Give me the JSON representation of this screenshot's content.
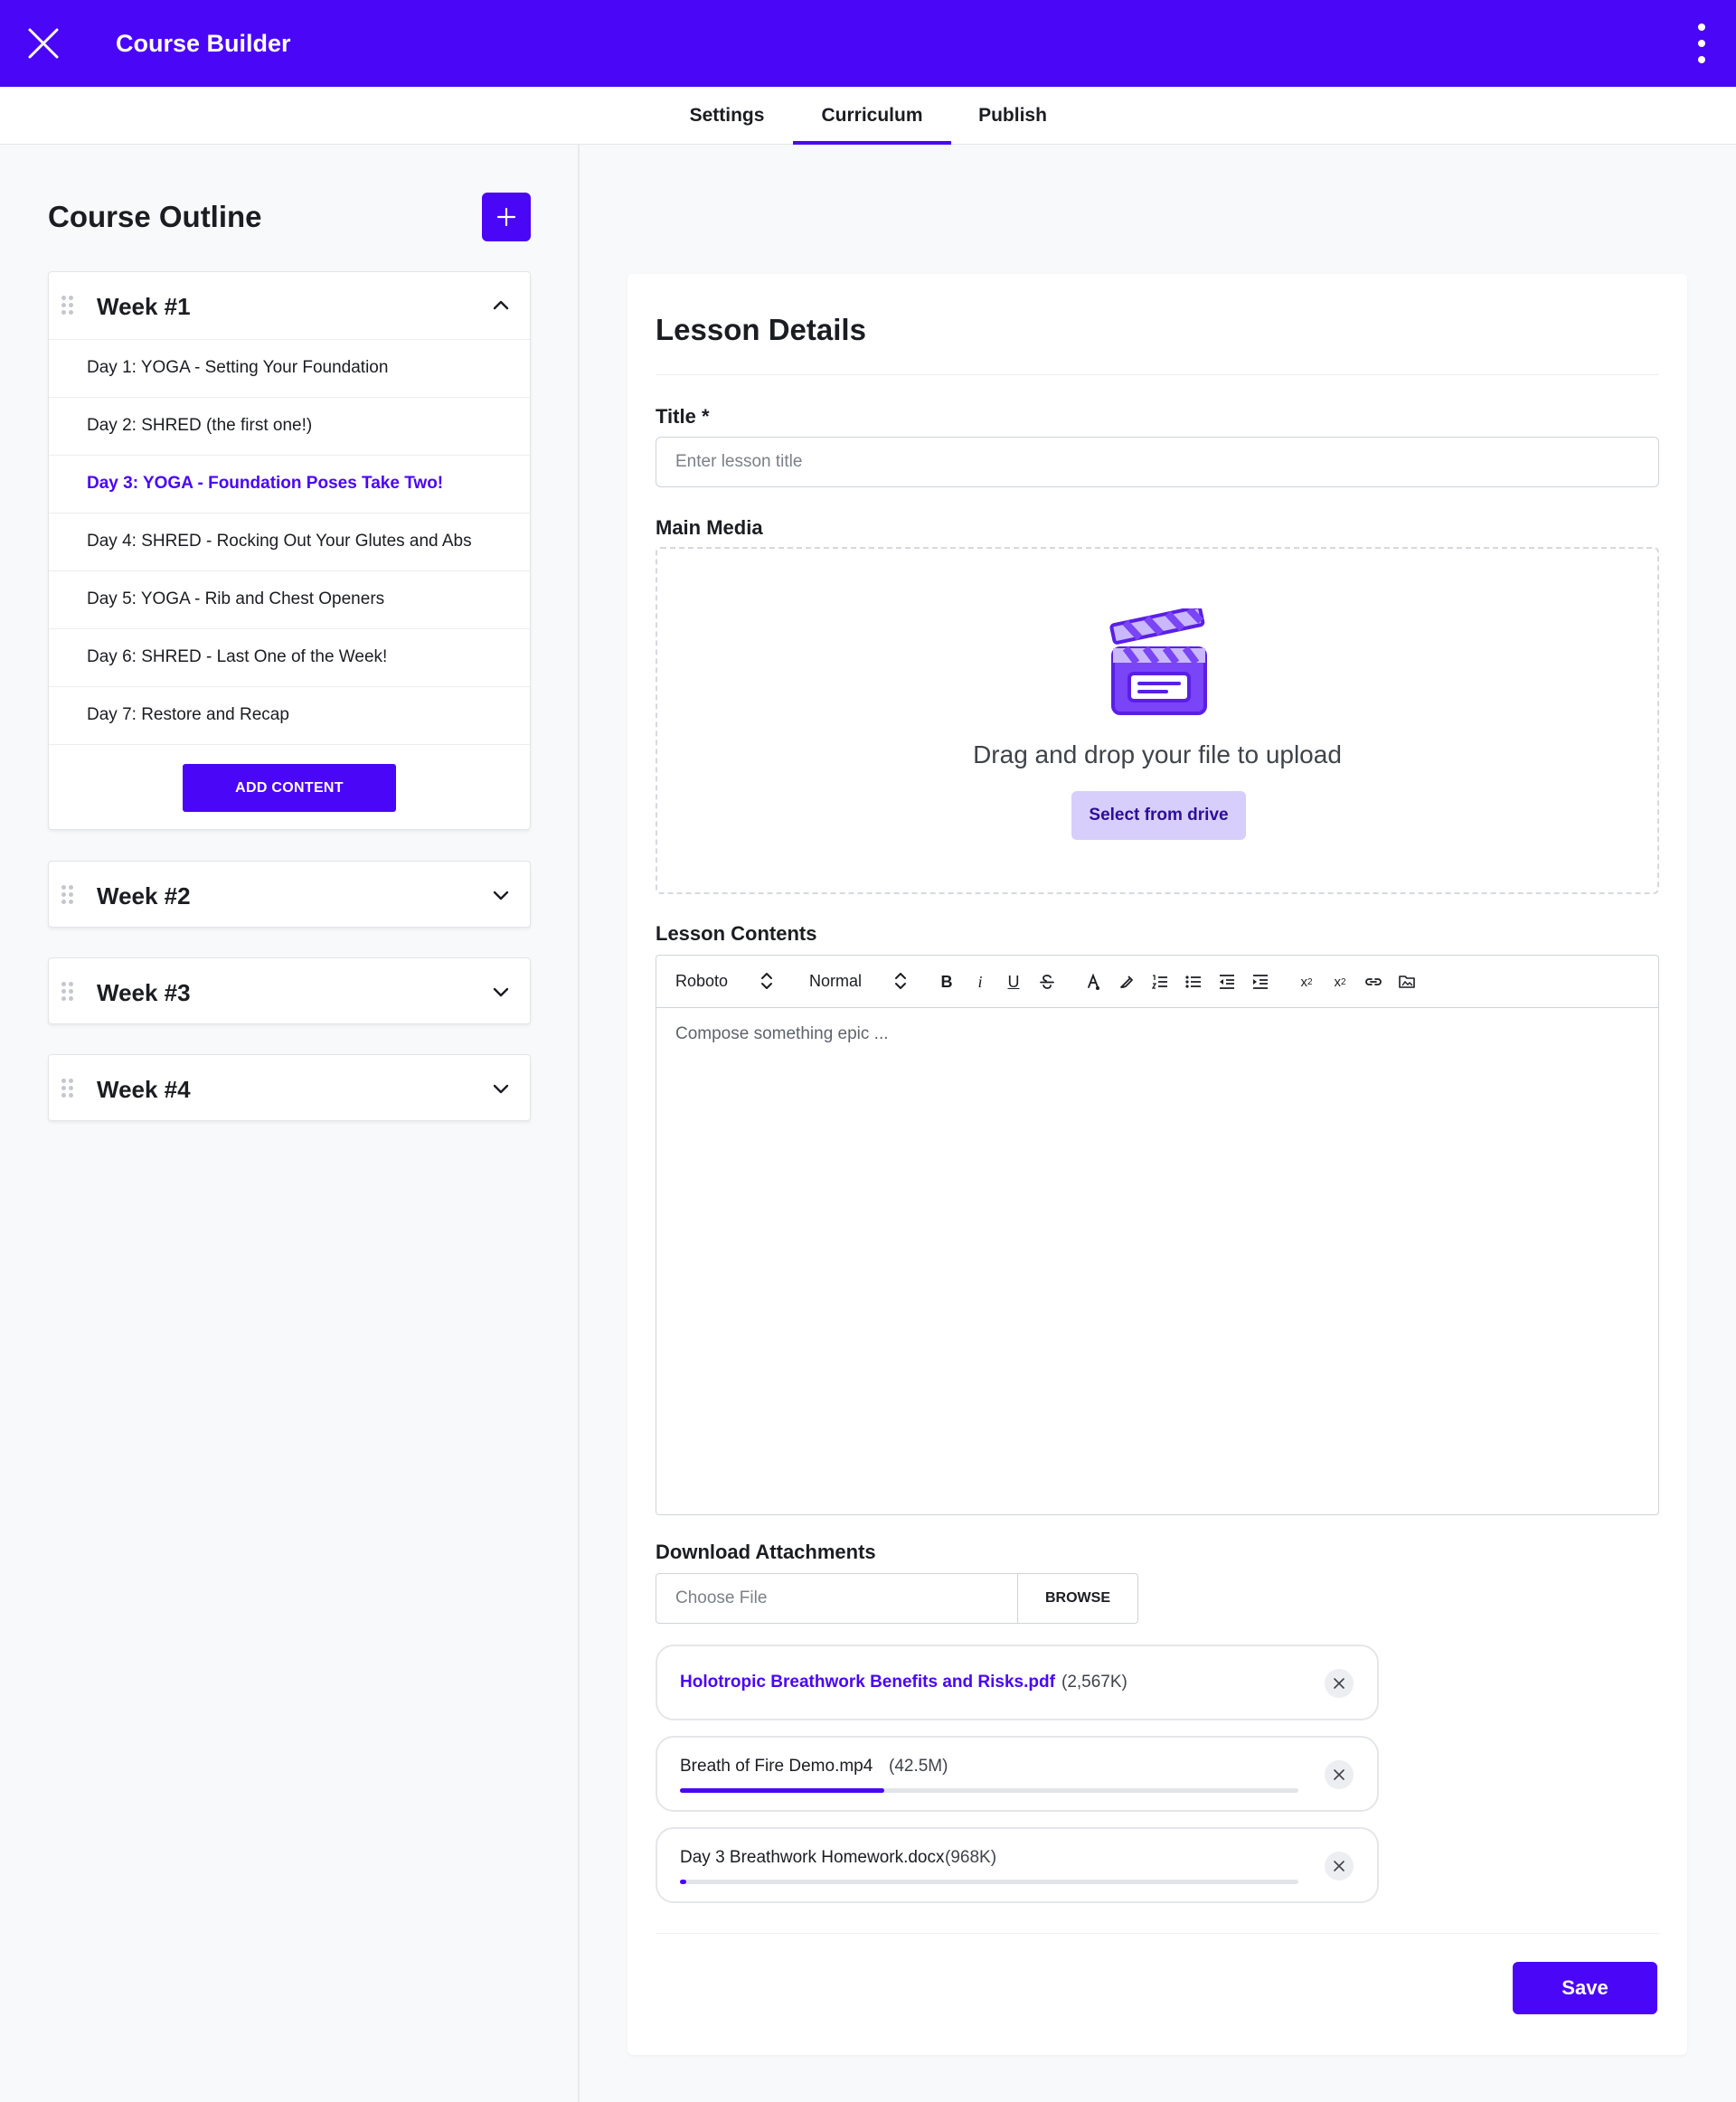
{
  "app": {
    "title": "Course Builder",
    "accent_color": "#4a06f7",
    "close_icon": "close-icon",
    "menu_icon": "more-vertical-icon"
  },
  "tabs": [
    {
      "label": "Settings",
      "active": false
    },
    {
      "label": "Curriculum",
      "active": true
    },
    {
      "label": "Publish",
      "active": false
    }
  ],
  "outline": {
    "title": "Course Outline",
    "add_icon": "plus-icon",
    "weeks": [
      {
        "label": "Week #1",
        "expanded": true,
        "days": [
          {
            "label": "Day 1: YOGA - Setting Your Foundation",
            "active": false
          },
          {
            "label": "Day 2: SHRED (the first one!)",
            "active": false
          },
          {
            "label": "Day 3: YOGA - Foundation Poses Take Two!",
            "active": true
          },
          {
            "label": "Day 4: SHRED - Rocking Out Your Glutes and Abs",
            "active": false
          },
          {
            "label": "Day 5: YOGA - Rib and Chest Openers",
            "active": false
          },
          {
            "label": "Day 6: SHRED - Last One of the Week!",
            "active": false
          },
          {
            "label": "Day 7: Restore and Recap",
            "active": false
          }
        ],
        "add_content_label": "ADD CONTENT"
      },
      {
        "label": "Week #2",
        "expanded": false
      },
      {
        "label": "Week #3",
        "expanded": false
      },
      {
        "label": "Week #4",
        "expanded": false
      }
    ]
  },
  "lesson": {
    "heading": "Lesson Details",
    "title_label": "Title *",
    "title_placeholder": "Enter lesson title",
    "title_value": "",
    "media_label": "Main Media",
    "media_icon": "video-clapperboard-icon",
    "drop_text": "Drag and drop your file to upload",
    "select_drive_label": "Select from drive",
    "contents_label": "Lesson Contents",
    "editor": {
      "font": "Roboto",
      "style": "Normal",
      "placeholder": "Compose something epic ...",
      "toolbar_icons": [
        "bold-icon",
        "italic-icon",
        "underline-icon",
        "strikethrough-icon",
        "text-color-icon",
        "highlight-icon",
        "ordered-list-icon",
        "bullet-list-icon",
        "outdent-icon",
        "indent-icon",
        "subscript-icon",
        "superscript-icon",
        "link-icon",
        "image-icon"
      ]
    },
    "attachments_label": "Download Attachments",
    "choose_file_placeholder": "Choose File",
    "browse_label": "BROWSE",
    "attachments": [
      {
        "name": "Holotropic Breathwork Benefits and Risks.pdf",
        "size": "(2,567K)",
        "uploaded": true,
        "progress": 1.0
      },
      {
        "name": "Breath of Fire Demo.mp4",
        "size": "(42.5M)",
        "uploaded": false,
        "progress": 0.33
      },
      {
        "name": "Day 3 Breathwork Homework.docx",
        "size": "(968K)",
        "uploaded": false,
        "progress": 0.01
      }
    ],
    "save_label": "Save"
  }
}
